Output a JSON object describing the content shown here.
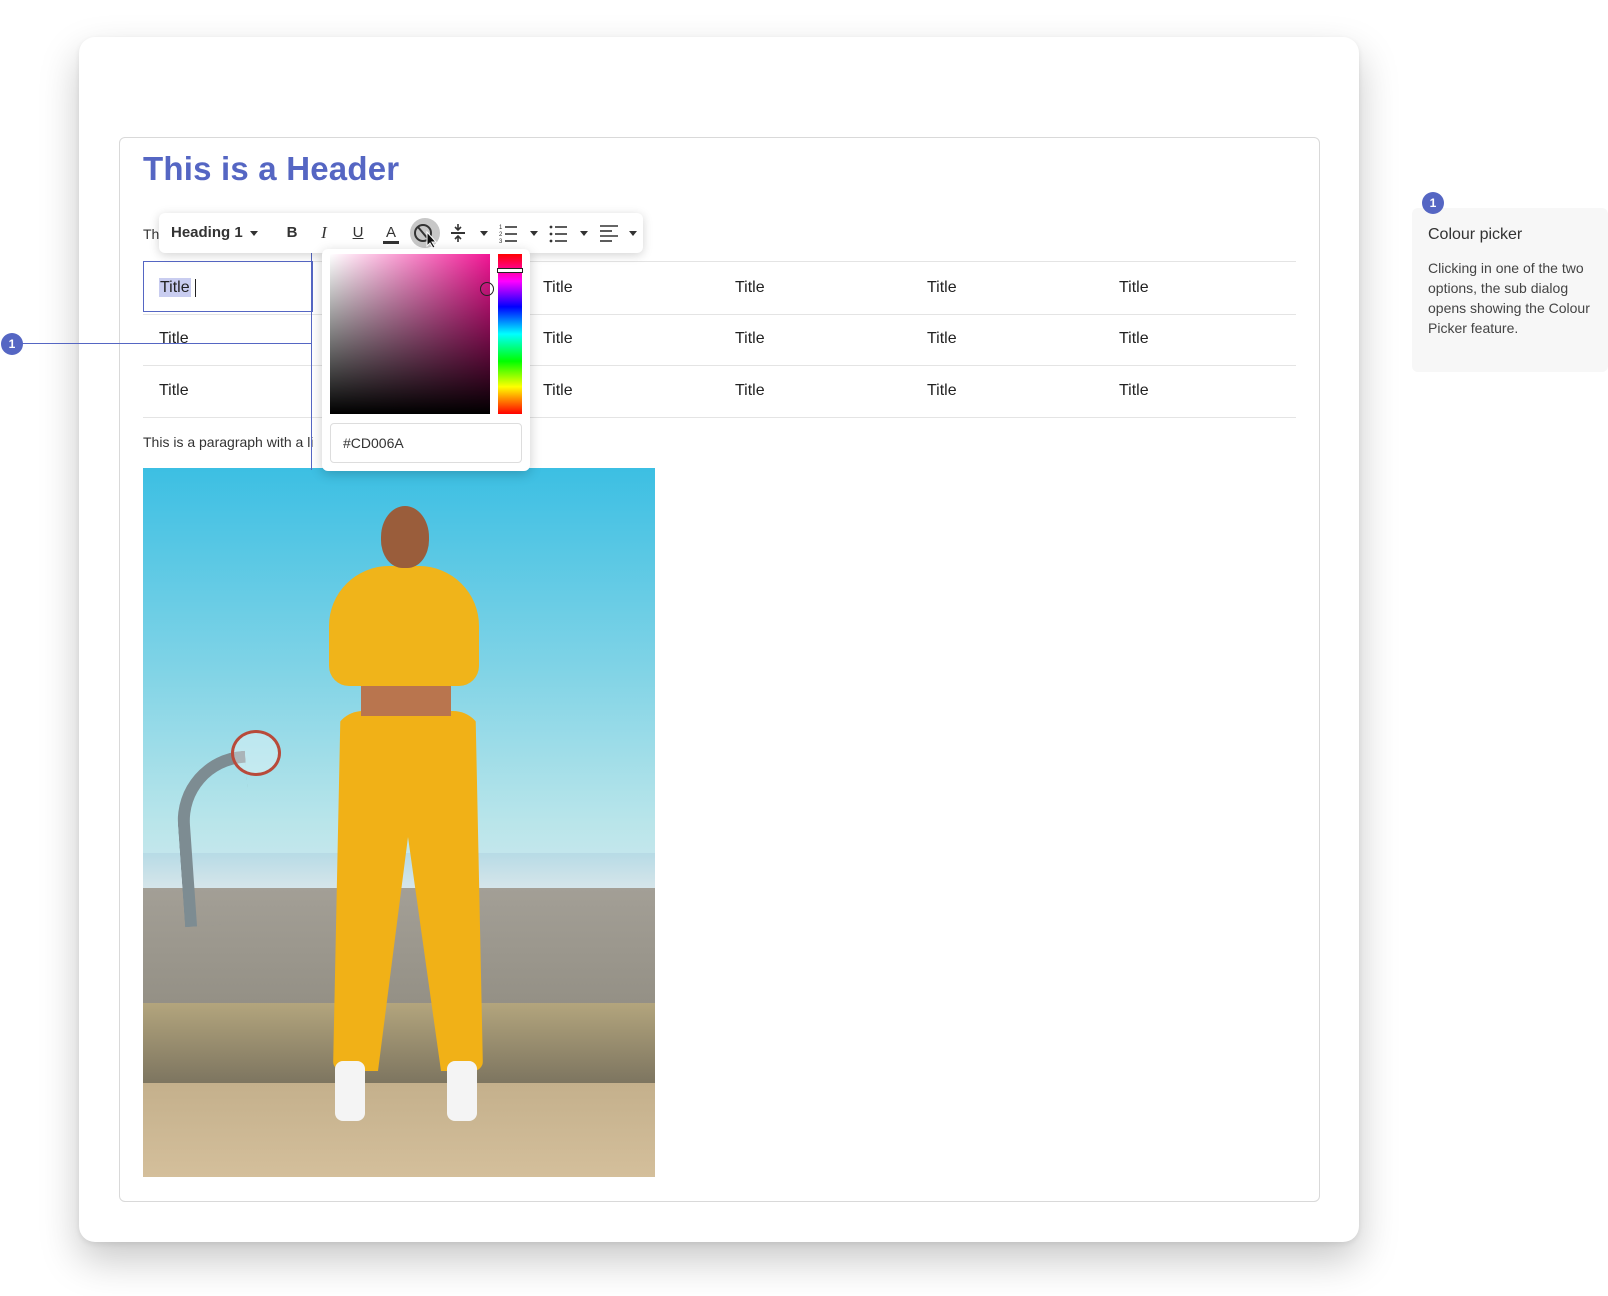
{
  "editor": {
    "header": "This is a Header",
    "intro_fragment": "Th",
    "paragraph": "This is a paragraph with a li",
    "table": {
      "rows": [
        [
          "Title",
          "Title",
          "Title",
          "Title",
          "Title"
        ],
        [
          "Title",
          "Title",
          "Title",
          "Title",
          "Title"
        ],
        [
          "Title",
          "Title",
          "Title",
          "Title",
          "Title"
        ]
      ]
    },
    "image": {
      "subject": "person-in-yellow-tracksuit-basketball-court"
    }
  },
  "toolbar": {
    "style_label": "Heading 1",
    "bold_label": "B",
    "italic_label": "I",
    "underline_label": "U",
    "text_color_label": "A",
    "icons": [
      "bold-icon",
      "italic-icon",
      "underline-icon",
      "text-color-icon",
      "highlight-color-icon",
      "spacing-icon",
      "numbered-list-icon",
      "bulleted-list-icon",
      "align-left-icon"
    ]
  },
  "color_picker": {
    "hex_value": "#CD006A",
    "selected_color": "#CD006A",
    "hue_color": "#F21695"
  },
  "annotation": {
    "number": "1",
    "title": "Colour picker",
    "body": "Clicking in one of the two options, the sub dialog opens showing the Colour Picker feature."
  },
  "colors": {
    "accent": "#5566C3",
    "selection": "#C9CDF0"
  }
}
